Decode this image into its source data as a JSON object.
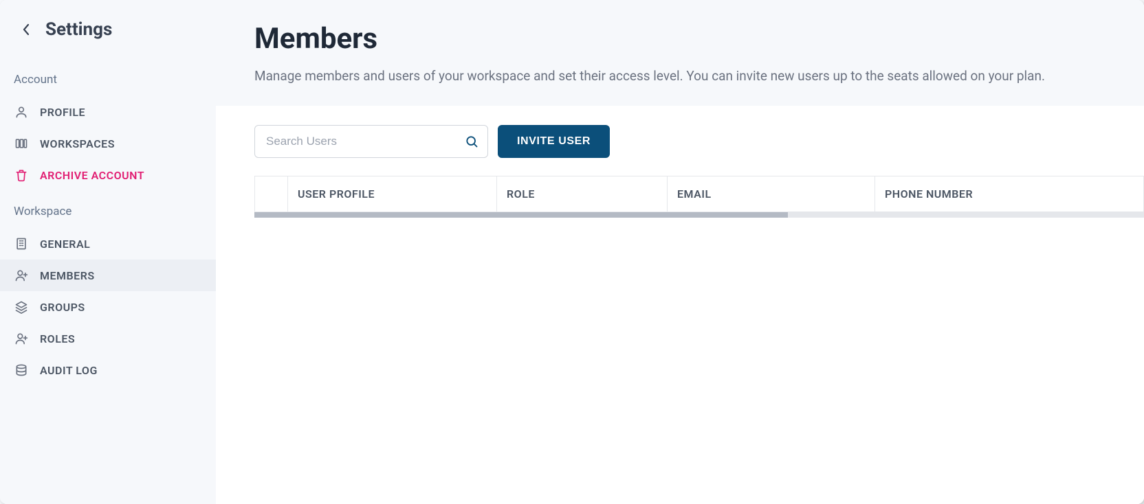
{
  "sidebar": {
    "title": "Settings",
    "sections": [
      {
        "title": "Account",
        "items": [
          {
            "key": "profile",
            "label": "PROFILE",
            "icon": "user"
          },
          {
            "key": "workspaces",
            "label": "WORKSPACES",
            "icon": "columns"
          },
          {
            "key": "archive-account",
            "label": "ARCHIVE ACCOUNT",
            "icon": "trash",
            "danger": true
          }
        ]
      },
      {
        "title": "Workspace",
        "items": [
          {
            "key": "general",
            "label": "GENERAL",
            "icon": "building"
          },
          {
            "key": "members",
            "label": "MEMBERS",
            "icon": "user-plus",
            "active": true
          },
          {
            "key": "groups",
            "label": "GROUPS",
            "icon": "layers"
          },
          {
            "key": "roles",
            "label": "ROLES",
            "icon": "user-plus"
          },
          {
            "key": "audit-log",
            "label": "AUDIT LOG",
            "icon": "database"
          }
        ]
      }
    ]
  },
  "main": {
    "title": "Members",
    "description": "Manage members and users of your workspace and set their access level. You can invite new users up to the seats allowed on your plan.",
    "search": {
      "placeholder": "Search Users",
      "value": ""
    },
    "invite_button_label": "INVITE USER",
    "table": {
      "columns": [
        {
          "key": "checkbox",
          "label": ""
        },
        {
          "key": "user_profile",
          "label": "USER PROFILE"
        },
        {
          "key": "role",
          "label": "ROLE"
        },
        {
          "key": "email",
          "label": "EMAIL"
        },
        {
          "key": "phone_number",
          "label": "PHONE NUMBER"
        }
      ],
      "rows": []
    }
  },
  "colors": {
    "accent": "#0b4f7a",
    "danger": "#e11d72",
    "text_primary": "#1f2937",
    "text_secondary": "#6b7280",
    "sidebar_bg": "#f6f8fb"
  }
}
